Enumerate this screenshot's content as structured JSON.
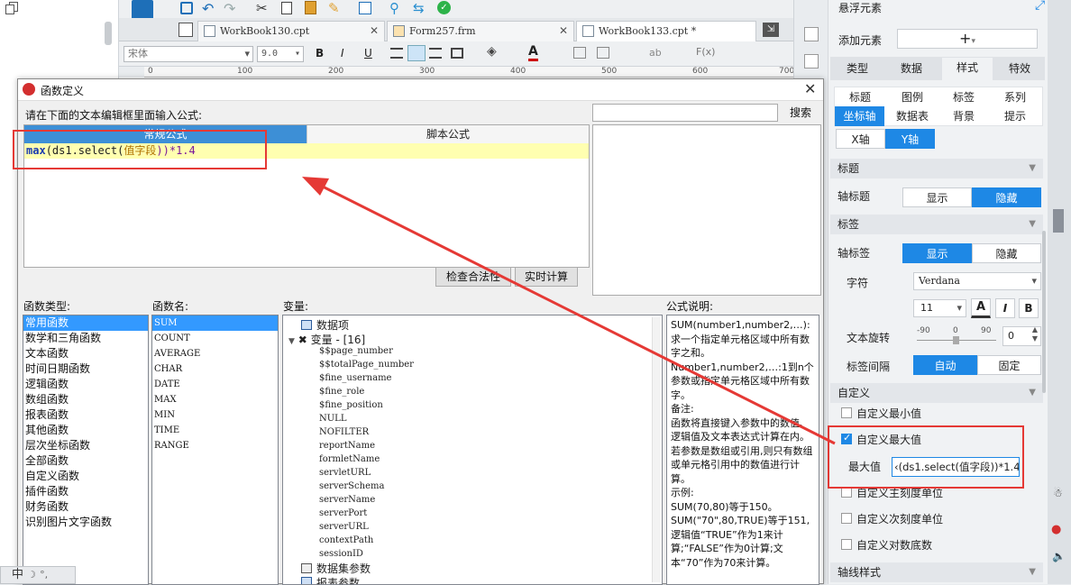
{
  "tabs": [
    {
      "label": "WorkBook130.cpt"
    },
    {
      "label": "Form257.frm"
    },
    {
      "label": "WorkBook133.cpt *"
    }
  ],
  "format_bar": {
    "font": "宋体",
    "size": "9.0",
    "bold": "B",
    "italic": "I",
    "underline": "U"
  },
  "ruler": [
    "0",
    "100",
    "200",
    "300",
    "400",
    "500",
    "600",
    "700"
  ],
  "dialog": {
    "title": "函数定义",
    "prompt": "请在下面的文本编辑框里面输入公式:",
    "tab_normal": "常规公式",
    "tab_script": "脚本公式",
    "formula": {
      "fn": "max",
      "args": "(ds1.select(",
      "param": "值字段",
      "tail": "))*1.4"
    },
    "search_btn": "搜索",
    "check_btn": "检查合法性",
    "calc_btn": "实时计算",
    "labels": {
      "fn_type": "函数类型:",
      "fn_name": "函数名:",
      "vars": "变量:",
      "desc": "公式说明:"
    },
    "fn_types": [
      "常用函数",
      "数学和三角函数",
      "文本函数",
      "时间日期函数",
      "逻辑函数",
      "数组函数",
      "报表函数",
      "其他函数",
      "层次坐标函数",
      "全部函数",
      "自定义函数",
      "插件函数",
      "财务函数",
      "识别图片文字函数"
    ],
    "fn_names": [
      "SUM",
      "COUNT",
      "AVERAGE",
      "CHAR",
      "DATE",
      "MAX",
      "MIN",
      "TIME",
      "RANGE"
    ],
    "vars": {
      "data_item": "数据项",
      "var_group": "变量 - [16]",
      "items": [
        "$$page_number",
        "$$totalPage_number",
        "$fine_username",
        "$fine_role",
        "$fine_position",
        "NULL",
        "NOFILTER",
        "reportName",
        "formletName",
        "servletURL",
        "serverSchema",
        "serverName",
        "serverPort",
        "serverURL",
        "contextPath",
        "sessionID"
      ],
      "dataset_param": "数据集参数",
      "report_param": "报表参数"
    },
    "description": "SUM(number1,number2,…):求一个指定单元格区域中所有数字之和。\nNumber1,number2,…:1到n个参数或指定单元格区域中所有数字。\n备注:\n函数将直接键入参数中的数值、逻辑值及文本表达式计算在内。若参数是数组或引用,则只有数组或单元格引用中的数值进行计算。\n示例:\nSUM(70,80)等于150。\nSUM(\"70\",80,TRUE)等于151,逻辑值“TRUE”作为1来计算;“FALSE”作为0计算;文本“70”作为70来计算。"
  },
  "right_panel": {
    "title": "悬浮元素",
    "add_label": "添加元素",
    "main_tabs": [
      "类型",
      "数据",
      "样式",
      "特效"
    ],
    "sub_tabs_row1": [
      "标题",
      "图例",
      "标签",
      "系列"
    ],
    "sub_tabs_row2": [
      "坐标轴",
      "数据表",
      "背景",
      "提示"
    ],
    "axis_tabs": [
      "X轴",
      "Y轴"
    ],
    "sec_title": "标题",
    "axis_title": "轴标题",
    "show": "显示",
    "hide": "隐藏",
    "sec_label": "标签",
    "axis_label": "轴标签",
    "char": "字符",
    "font": "Verdana",
    "font_size": "11",
    "rotate": "文本旋转",
    "rot_min": "-90",
    "rot_mid": "0",
    "rot_max": "90",
    "rot_val": "0",
    "interval": "标签间隔",
    "auto": "自动",
    "fixed": "固定",
    "sec_custom": "自定义",
    "custom_min": "自定义最小值",
    "custom_max": "自定义最大值",
    "max_label": "最大值",
    "max_value": "‹(ds1.select(值字段))*1.4",
    "major_unit": "自定义主刻度单位",
    "minor_unit": "自定义次刻度单位",
    "log_base": "自定义对数底数",
    "sec_axisline": "轴线样式"
  },
  "ime": "中",
  "colors": {
    "accent": "#1e88e5",
    "annotation": "#e53935",
    "highlight": "#ffffb0"
  }
}
